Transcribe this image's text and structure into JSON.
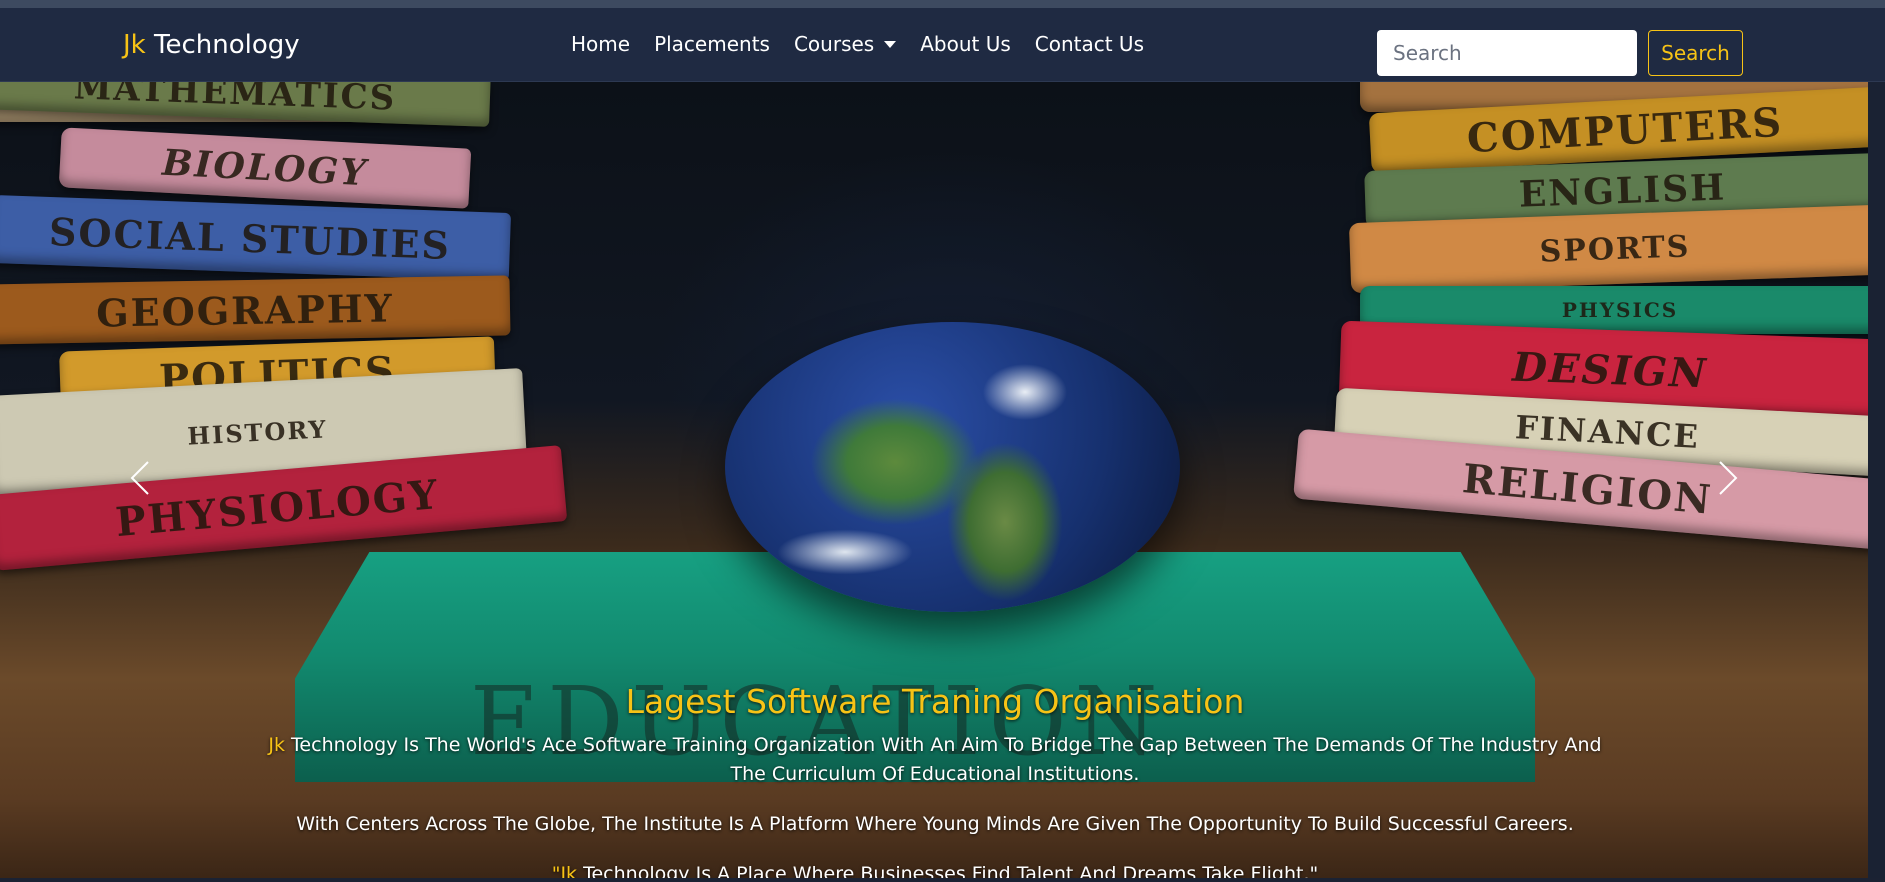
{
  "brand": {
    "prefix": "Jk",
    "name": "Technology"
  },
  "nav": {
    "home": "Home",
    "placements": "Placements",
    "courses": "Courses",
    "about": "About Us",
    "contact": "Contact Us"
  },
  "search": {
    "placeholder": "Search",
    "button": "Search"
  },
  "hero": {
    "books_left": [
      "Mathematics",
      "Biology",
      "Social Studies",
      "Geography",
      "Politics",
      "History",
      "Physiology"
    ],
    "books_right": [
      "Computers",
      "English",
      "Sports",
      "Physics",
      "Design",
      "Finance",
      "Religion"
    ],
    "center_book": "EDUCATION",
    "title": "Lagest Software Traning Organisation",
    "para1_prefix": "Jk",
    "para1_rest": " Technology Is The World's Ace Software Training Organization With An Aim To Bridge The Gap Between The Demands Of The Industry And The Curriculum Of Educational Institutions.",
    "para2": "With Centers Across The Globe, The Institute Is A Platform Where Young Minds Are Given The Opportunity To Build Successful Careers.",
    "para3_prefix": "\"Jk",
    "para3_rest": " Technology Is A Place Where Businesses Find Talent And Dreams Take Flight.\""
  },
  "colors": {
    "accent": "#f7c316",
    "navbar": "#1f2a42"
  },
  "icons": {
    "prev": "chevron-left-icon",
    "next": "chevron-right-icon",
    "dropdown": "caret-down-icon"
  }
}
